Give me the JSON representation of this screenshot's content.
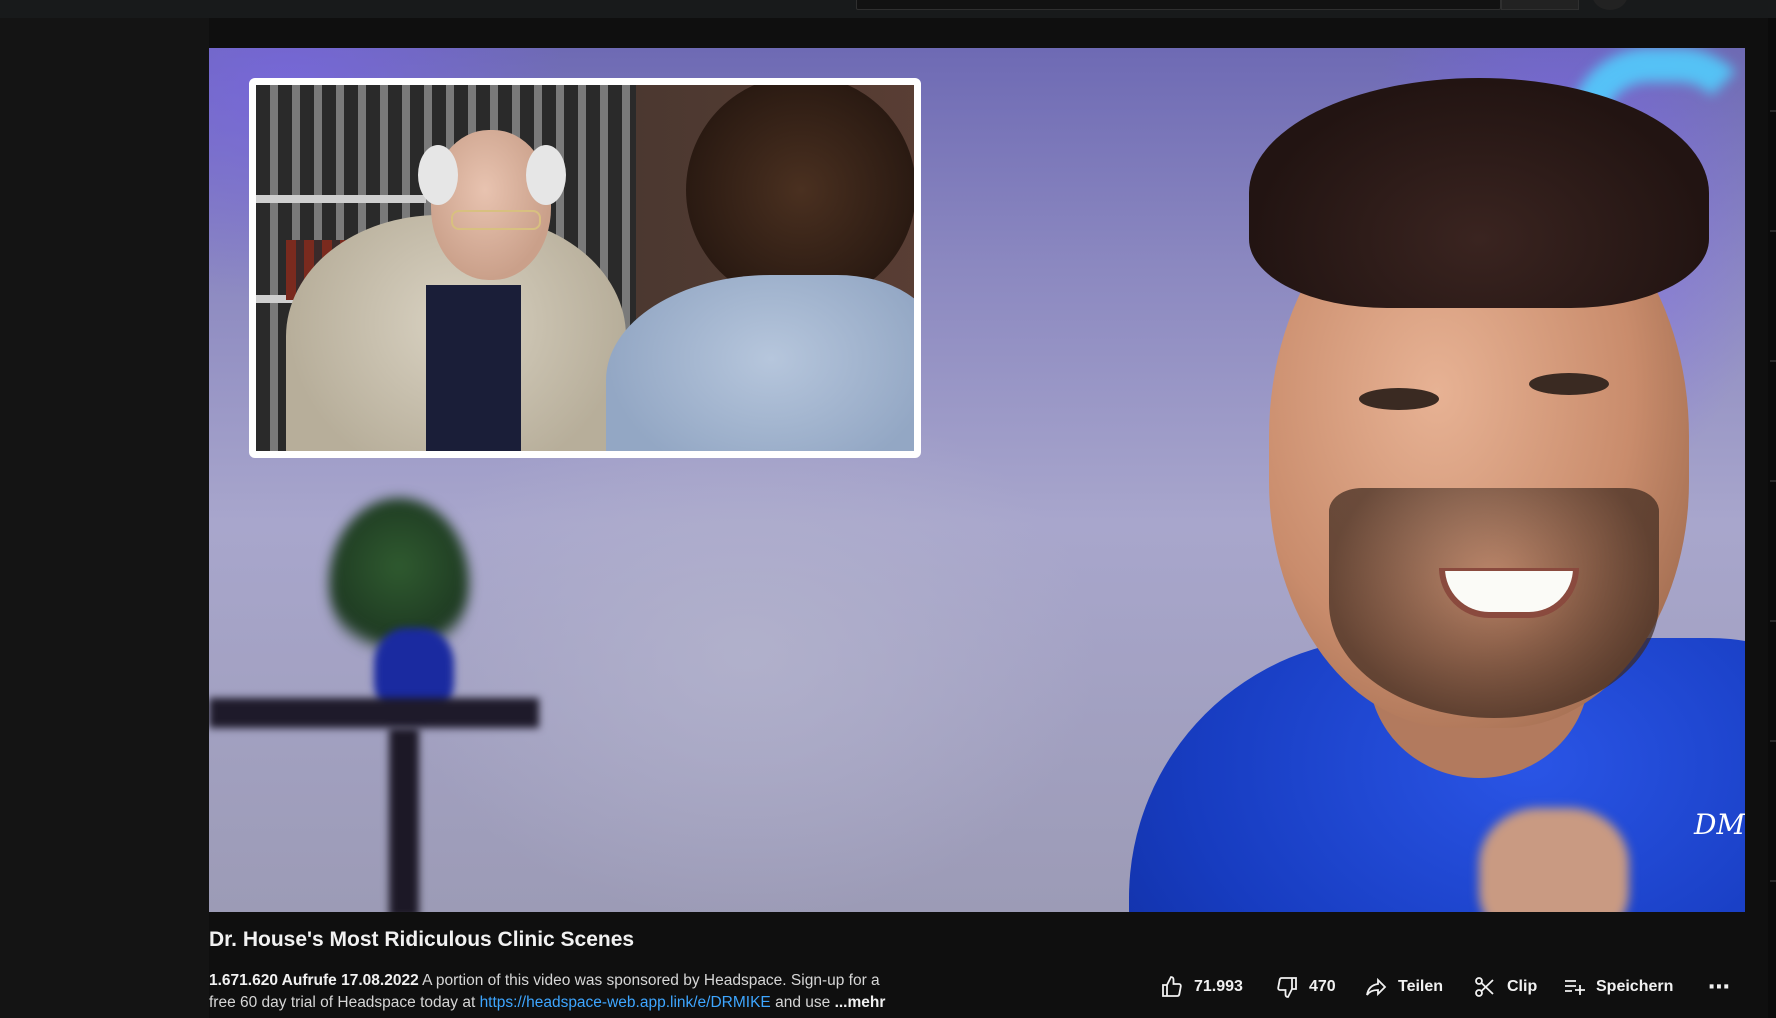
{
  "video": {
    "title": "Dr. House's Most Ridiculous Clinic Scenes",
    "views": "1.671.620 Aufrufe",
    "date": "17.08.2022",
    "description_line1": "A portion of this video was sponsored by Headspace. Sign-up for a",
    "description_line2_before": "free 60 day trial of Headspace today at ",
    "description_link": "https://headspace-web.app.link/e/DRMIKE",
    "description_after": " and use",
    "more_label": "...mehr",
    "watermark": "DM"
  },
  "actions": {
    "like_count": "71.993",
    "dislike_count": "470",
    "share_label": "Teilen",
    "clip_label": "Clip",
    "save_label": "Speichern",
    "more_icon": "⋯"
  },
  "colors": {
    "background": "#0f0f0f",
    "link": "#3ea6ff",
    "text": "#f1f1f1"
  }
}
